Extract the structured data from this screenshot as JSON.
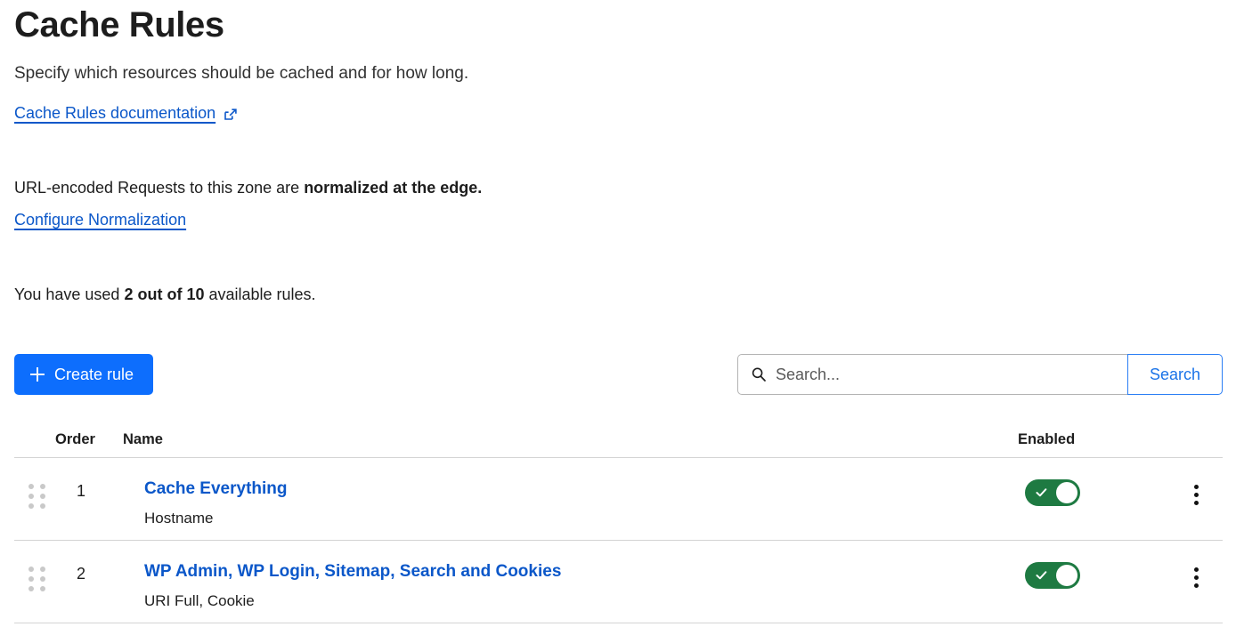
{
  "header": {
    "title": "Cache Rules",
    "subtitle": "Specify which resources should be cached and for how long.",
    "doc_link_label": "Cache Rules documentation",
    "doc_link_icon": "external-link-icon"
  },
  "normalization": {
    "text_prefix": "URL-encoded Requests to this zone are ",
    "text_bold": "normalized at the edge.",
    "configure_link_label": "Configure Normalization"
  },
  "usage": {
    "prefix": "You have used ",
    "bold": "2 out of 10",
    "suffix": " available rules.",
    "used": 2,
    "limit": 10
  },
  "actions": {
    "create_label": "Create rule",
    "create_icon": "plus-icon",
    "create_color": "#0d6efd",
    "search_placeholder": "Search...",
    "search_value": "",
    "search_icon": "magnifier-icon",
    "search_button_label": "Search",
    "search_button_color": "#2a7ef5"
  },
  "table": {
    "columns": {
      "order": "Order",
      "name": "Name",
      "enabled": "Enabled"
    },
    "toggle_on_color": "#1e7a42",
    "rows": [
      {
        "order": "1",
        "name": "Cache Everything",
        "sub": "Hostname",
        "enabled": true,
        "toggle_icon": "check-icon",
        "menu_icon": "kebab-menu-icon",
        "handle_icon": "drag-handle-icon"
      },
      {
        "order": "2",
        "name": "WP Admin, WP Login, Sitemap, Search and Cookies",
        "sub": "URI Full, Cookie",
        "enabled": true,
        "toggle_icon": "check-icon",
        "menu_icon": "kebab-menu-icon",
        "handle_icon": "drag-handle-icon"
      }
    ]
  }
}
